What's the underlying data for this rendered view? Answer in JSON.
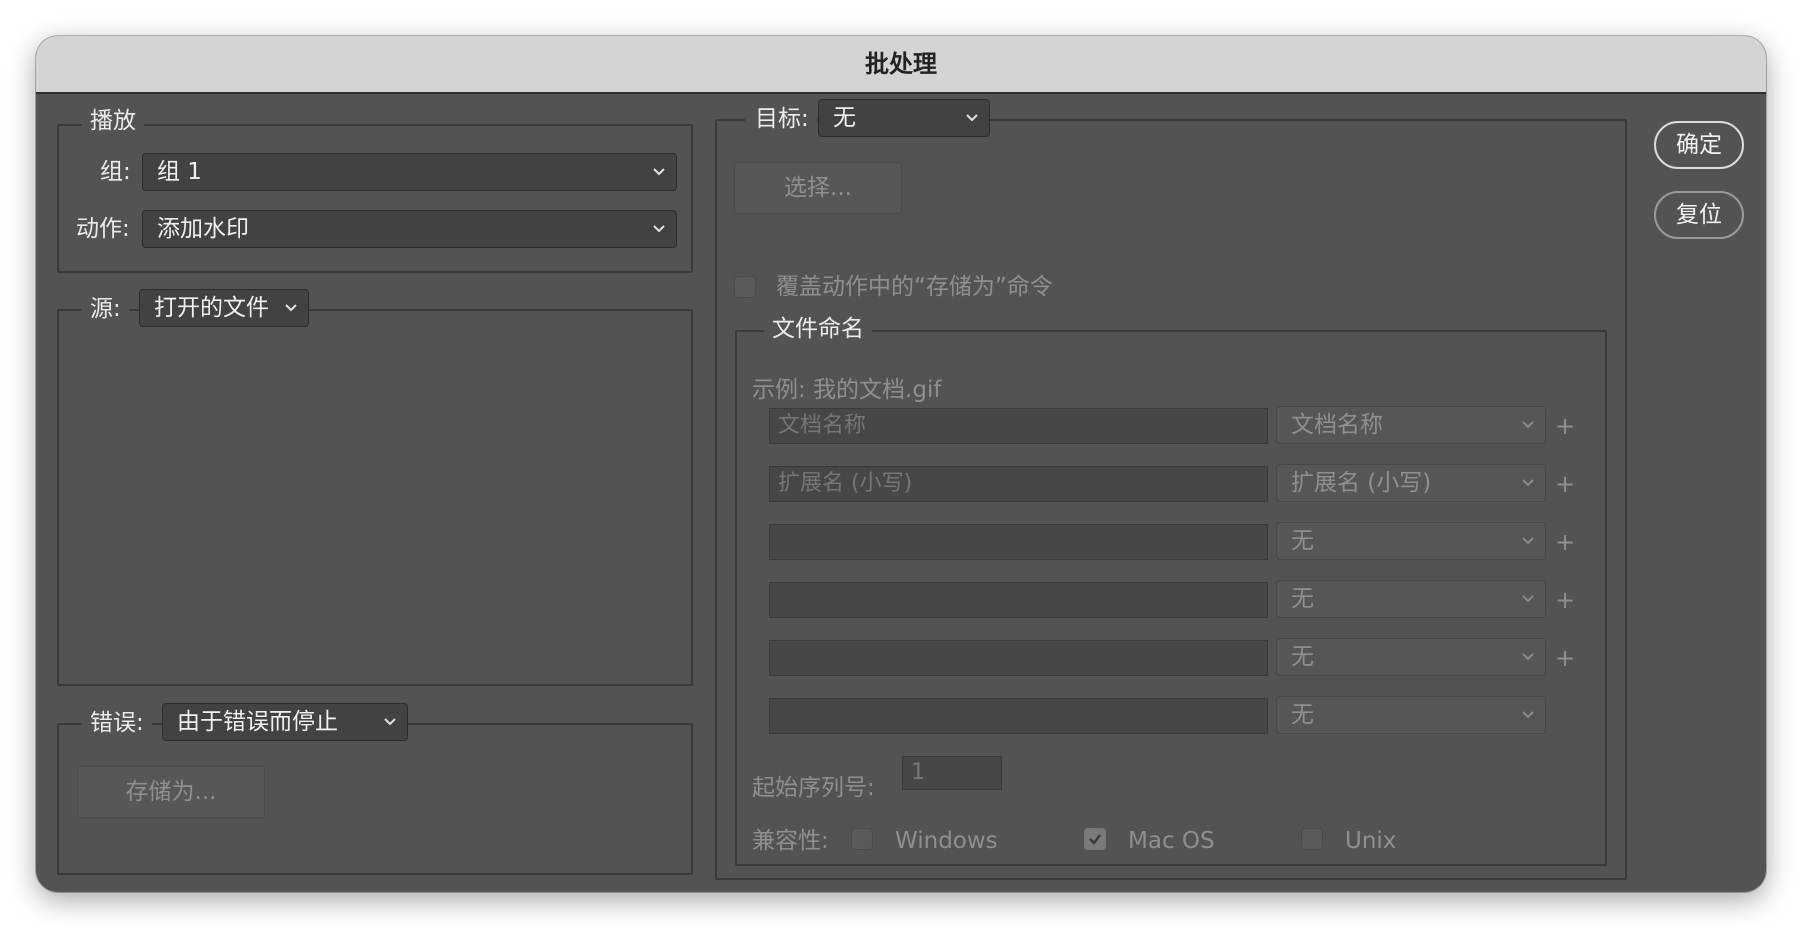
{
  "window": {
    "title": "批处理"
  },
  "buttons": {
    "ok": "确定",
    "reset": "复位"
  },
  "play": {
    "title": "播放",
    "group_label": "组:",
    "group_value": "组 1",
    "action_label": "动作:",
    "action_value": "添加水印"
  },
  "source": {
    "label": "源:",
    "value": "打开的文件"
  },
  "errors": {
    "label": "错误:",
    "value": "由于错误而停止",
    "save_as": "存储为..."
  },
  "destination": {
    "label": "目标:",
    "value": "无",
    "choose": "选择...",
    "override_label": "覆盖动作中的“存储为”命令",
    "override_checked": false
  },
  "file_naming": {
    "title": "文件命名",
    "example": "示例: 我的文档.gif",
    "rows": [
      {
        "field": "文档名称",
        "select": "文档名称",
        "plus": "+"
      },
      {
        "field": "扩展名 (小写)",
        "select": "扩展名 (小写)",
        "plus": "+"
      },
      {
        "field": "",
        "select": "无",
        "plus": "+"
      },
      {
        "field": "",
        "select": "无",
        "plus": "+"
      },
      {
        "field": "",
        "select": "无",
        "plus": "+"
      },
      {
        "field": "",
        "select": "无",
        "plus": ""
      }
    ],
    "serial_label": "起始序列号:",
    "serial_value": "1",
    "compat_label": "兼容性:",
    "compat": [
      {
        "label": "Windows",
        "checked": false
      },
      {
        "label": "Mac OS",
        "checked": true
      },
      {
        "label": "Unix",
        "checked": false
      }
    ]
  },
  "icons": {
    "dropdown": "chevron-down-icon",
    "checkbox_mark": "checkmark-icon"
  }
}
